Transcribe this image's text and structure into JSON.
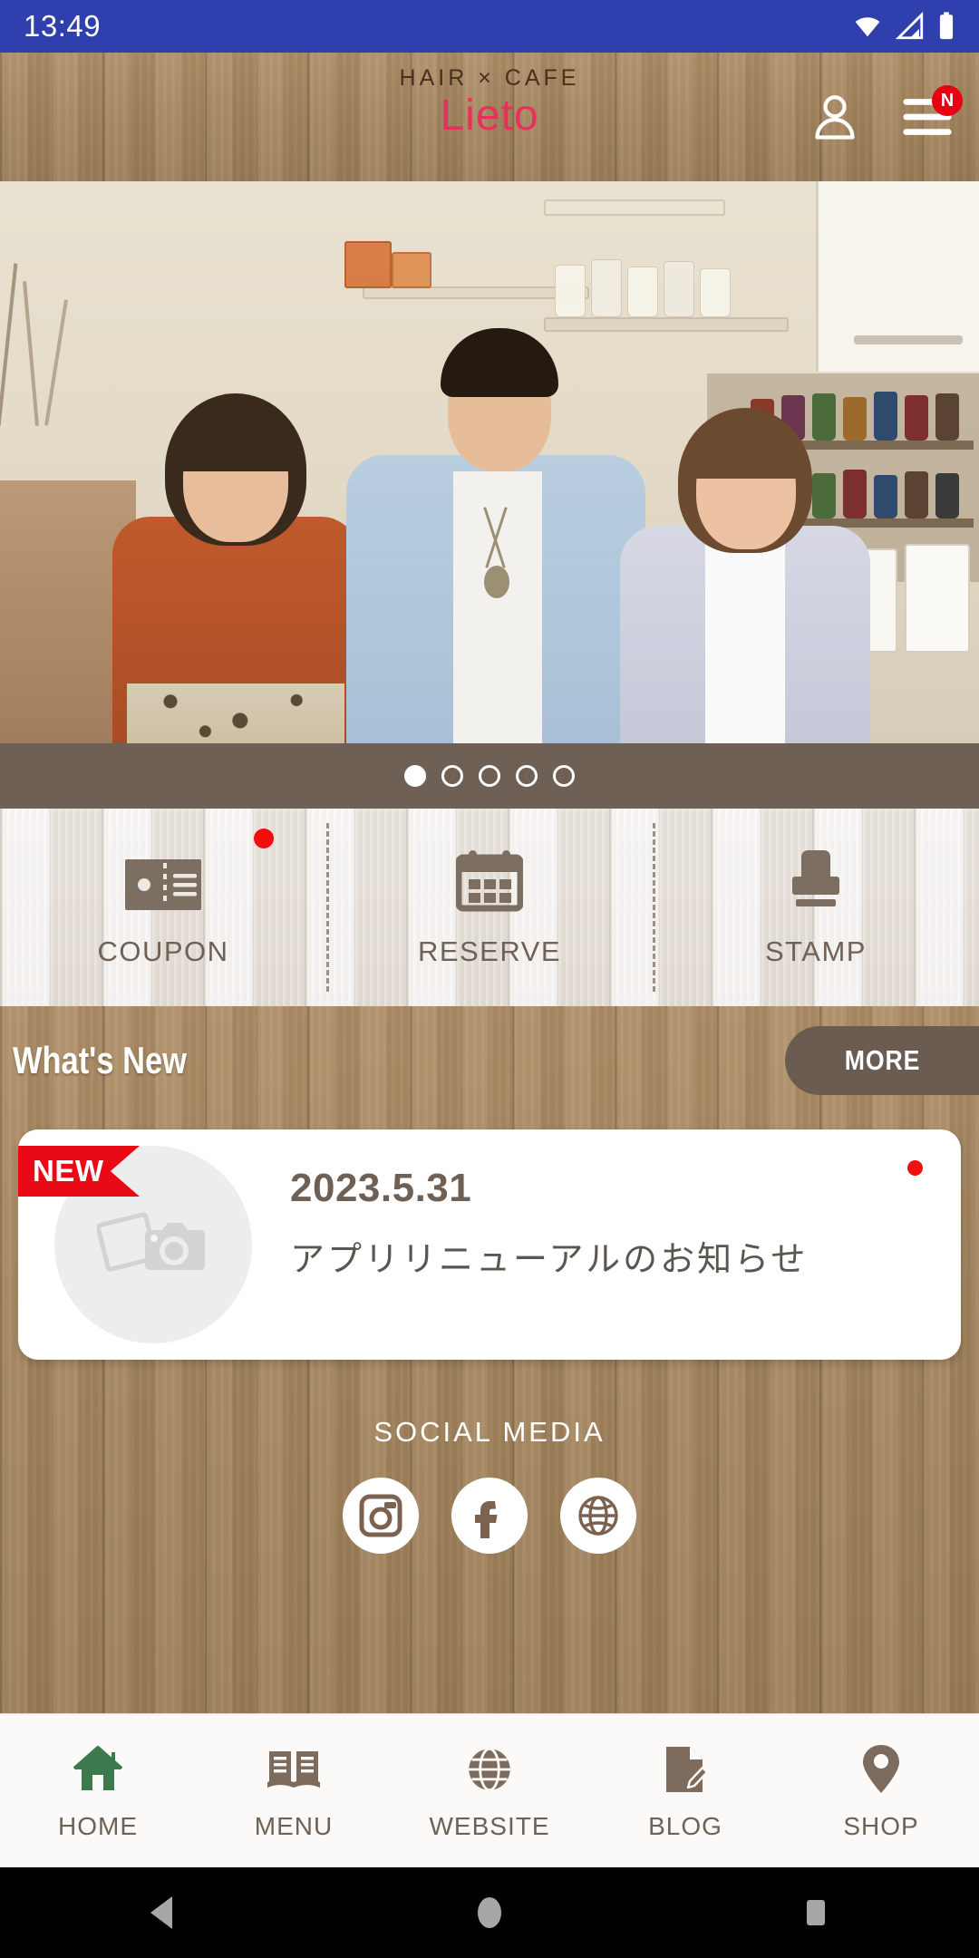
{
  "status_bar": {
    "time": "13:49",
    "icons": [
      "wifi-icon",
      "cellular-signal-icon",
      "battery-icon"
    ],
    "background_color": "#2f3fae"
  },
  "header": {
    "logo_top": "HAIR × CAFE",
    "logo_main": "Lieto",
    "logo_main_color": "#e8305c",
    "account_icon": "person-icon",
    "menu_icon": "hamburger-menu-icon",
    "menu_badge": "N",
    "menu_badge_color": "#e60012"
  },
  "carousel": {
    "total_slides": 5,
    "active_slide": 1,
    "band_color": "#6e6055"
  },
  "quick_actions": [
    {
      "label": "COUPON",
      "icon": "coupon-ticket-icon",
      "has_badge": true
    },
    {
      "label": "RESERVE",
      "icon": "calendar-icon",
      "has_badge": false
    },
    {
      "label": "STAMP",
      "icon": "rubber-stamp-icon",
      "has_badge": false
    }
  ],
  "whats_new": {
    "section_title": "What's New",
    "more_label": "MORE",
    "more_button_color": "#6b5c51",
    "items": [
      {
        "badge": "NEW",
        "badge_color": "#ea0a16",
        "date": "2023.5.31",
        "title": "アプリリニューアルのお知らせ",
        "thumbnail_icon": "photo-placeholder-icon",
        "unread": true
      }
    ]
  },
  "social_media": {
    "title": "SOCIAL MEDIA",
    "links": [
      {
        "name": "instagram-icon"
      },
      {
        "name": "facebook-icon"
      },
      {
        "name": "globe-icon"
      }
    ]
  },
  "bottom_nav": {
    "active_color": "#3c7a4e",
    "inactive_color": "#7d6b5d",
    "items": [
      {
        "label": "HOME",
        "icon": "home-icon",
        "active": true
      },
      {
        "label": "MENU",
        "icon": "book-icon",
        "active": false
      },
      {
        "label": "WEBSITE",
        "icon": "globe-icon",
        "active": false
      },
      {
        "label": "BLOG",
        "icon": "document-pencil-icon",
        "active": false
      },
      {
        "label": "SHOP",
        "icon": "map-pin-icon",
        "active": false
      }
    ]
  },
  "android_nav": {
    "back": "back-triangle-icon",
    "home": "home-circle-icon",
    "recents": "recents-square-icon"
  }
}
